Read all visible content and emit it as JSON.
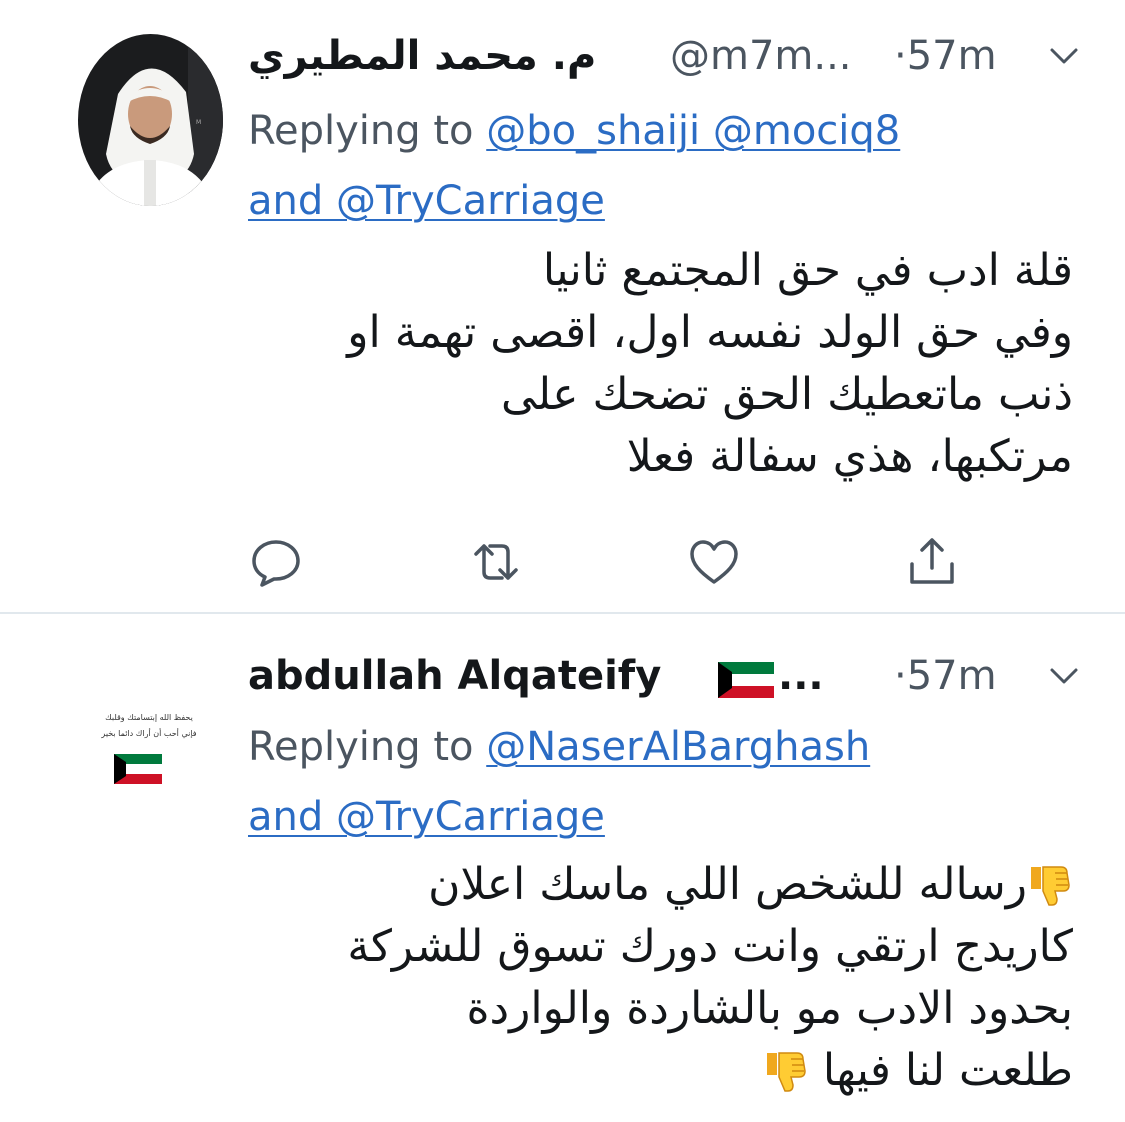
{
  "tweets": [
    {
      "display_name": "م. محمد المطيري",
      "handle": "@m7m...",
      "time": "·57m",
      "replying_prefix": "Replying to",
      "reply_mentions": "@bo_shaiji @mociq8",
      "reply_and": "and @TryCarriage",
      "body_lines": [
        "قلة ادب في حق المجتمع ثانيا",
        "وفي حق الولد نفسه اول، اقصى تهمة او",
        "ذنب ماتعطيك الحق تضحك على",
        "مرتكبها، هذي سفالة فعلا"
      ],
      "actions": [
        "reply-icon",
        "retweet-icon",
        "like-icon",
        "share-icon"
      ]
    },
    {
      "display_name": "abdullah Alqateify",
      "handle": "...",
      "time": "·57m",
      "replying_prefix": "Replying to",
      "reply_mentions": "@NaserAlBarghash",
      "reply_and": "and @TryCarriage",
      "body_lines": [
        "رساله للشخص اللي ماسك اعلان",
        "كاريدج ارتقي وانت دورك تسوق للشركة",
        "بحدود الادب مو بالشاردة والواردة",
        "طلعت لنا فيها"
      ],
      "avatar_text_lines": [
        "يحفظ الله إبتسامتك وقلبك",
        "فإني أحب أن أراك دائما بخير"
      ]
    }
  ],
  "colors": {
    "text": "#14171a",
    "secondary": "#4b5560",
    "link": "#2b6cc4",
    "divider": "#e1e8ed",
    "kuwait_green": "#007a3d",
    "kuwait_red": "#ce1126"
  }
}
